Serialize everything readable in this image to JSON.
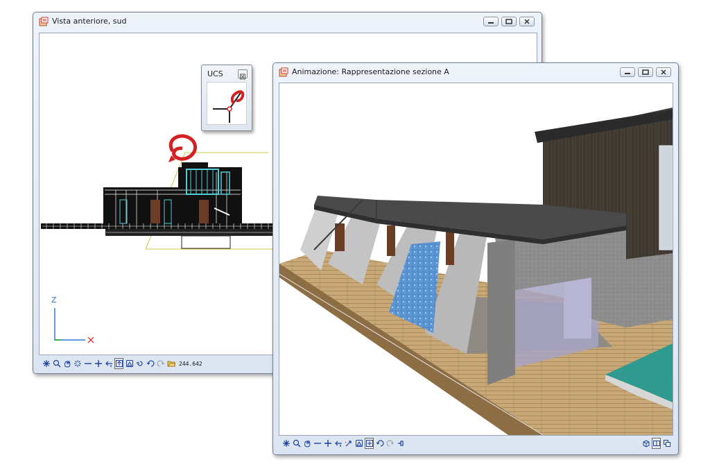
{
  "front_window": {
    "title": "Vista anteriore, sud",
    "axis_labels": {
      "z": "Z",
      "x": "X"
    },
    "toolbar_icons": [
      "asterisk-icon",
      "zoom-icon",
      "hand-pan-icon",
      "sparkle-icon",
      "minus-icon",
      "plus-icon",
      "arrow-left-icon",
      "view-front-icon",
      "view-home-icon",
      "rotate-icon",
      "undo-icon",
      "redo-icon",
      "folder-open-icon"
    ],
    "coordinate": "244.642"
  },
  "ucs_panel": {
    "title": "UCS",
    "close_label": "⊠"
  },
  "animation_window": {
    "title": "Animazione: Rappresentazione sezione A",
    "toolbar_icons": [
      "asterisk-icon",
      "zoom-icon",
      "hand-pan-icon",
      "minus-icon",
      "plus-icon",
      "arrow-left-icon",
      "magic-arrow-icon",
      "view-home-icon",
      "view-orbit-icon",
      "undo-icon",
      "redo-icon",
      "pin-icon"
    ],
    "right_icons": [
      "view-cube-icon",
      "split-view-icon",
      "copy-view-icon"
    ]
  },
  "colors": {
    "window_frame": "#dbe5f1",
    "accent_red": "#d42020",
    "ucs_line": "#c8c84a",
    "wood_floor": "#c8a877",
    "roof": "#4a4a4a",
    "tile_blue": "#4f86c6",
    "pool": "#2f9a8f"
  }
}
